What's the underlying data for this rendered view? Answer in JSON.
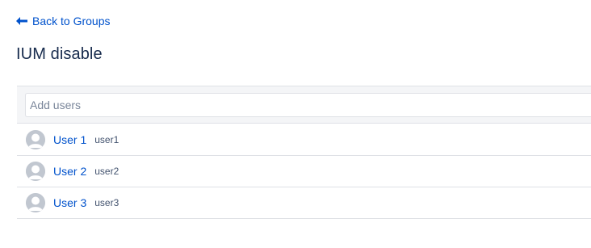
{
  "back_link": {
    "label": "Back to Groups",
    "icon": "arrow-left-icon"
  },
  "page_title": "IUM disable",
  "add_users": {
    "placeholder": "Add users",
    "value": ""
  },
  "users": [
    {
      "name": "User 1",
      "username": "user1",
      "icon": "avatar-icon"
    },
    {
      "name": "User 2",
      "username": "user2",
      "icon": "avatar-icon"
    },
    {
      "name": "User 3",
      "username": "user3",
      "icon": "avatar-icon"
    }
  ],
  "colors": {
    "link": "#0052cc",
    "text": "#172b4d",
    "border": "#dfe1e6",
    "panel_bg": "#f4f5f7",
    "avatar": "#c1c7d0"
  }
}
